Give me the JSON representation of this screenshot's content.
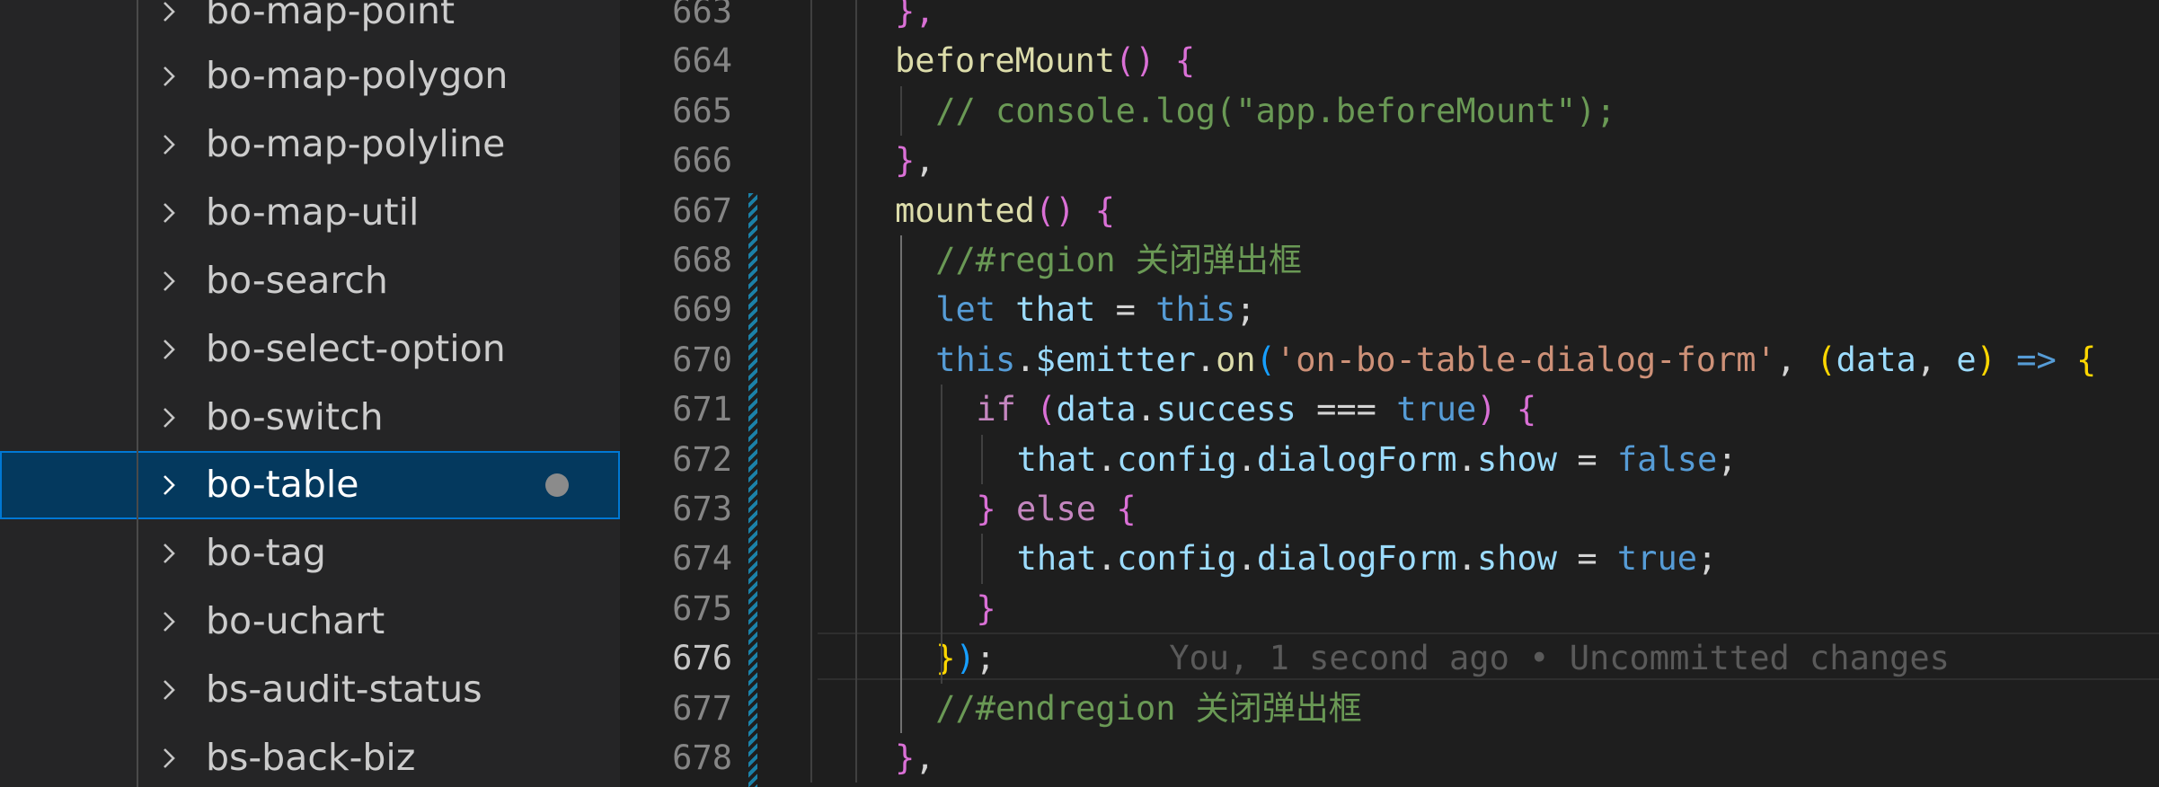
{
  "explorer": {
    "items": [
      {
        "label": "bo-map-point",
        "selected": false,
        "modified": false
      },
      {
        "label": "bo-map-polygon",
        "selected": false,
        "modified": false
      },
      {
        "label": "bo-map-polyline",
        "selected": false,
        "modified": false
      },
      {
        "label": "bo-map-util",
        "selected": false,
        "modified": false
      },
      {
        "label": "bo-search",
        "selected": false,
        "modified": false
      },
      {
        "label": "bo-select-option",
        "selected": false,
        "modified": false
      },
      {
        "label": "bo-switch",
        "selected": false,
        "modified": false
      },
      {
        "label": "bo-table",
        "selected": true,
        "modified": true
      },
      {
        "label": "bo-tag",
        "selected": false,
        "modified": false
      },
      {
        "label": "bo-uchart",
        "selected": false,
        "modified": false
      },
      {
        "label": "bs-audit-status",
        "selected": false,
        "modified": false
      },
      {
        "label": "bs-back-biz",
        "selected": false,
        "modified": false
      }
    ],
    "chevron_icon": "chevron-right-icon",
    "modified_color": "#8b8b8b",
    "selection_color": "#04395e",
    "selection_border": "#0078d4"
  },
  "editor": {
    "current_line": "676",
    "blame": "You, 1 second ago • Uncommitted changes",
    "lines": [
      {
        "num": "663",
        "tokens": [
          {
            "t": "},",
            "c": "br2"
          }
        ]
      },
      {
        "num": "664",
        "tokens": [
          {
            "t": "beforeMount",
            "c": "fn"
          },
          {
            "t": "()",
            "c": "br2"
          },
          {
            "t": " ",
            "c": "p"
          },
          {
            "t": "{",
            "c": "br2"
          }
        ]
      },
      {
        "num": "665",
        "tokens": [
          {
            "t": "// console.log(\"app.beforeMount\");",
            "c": "cmt"
          }
        ]
      },
      {
        "num": "666",
        "tokens": [
          {
            "t": "}",
            "c": "br2"
          },
          {
            "t": ",",
            "c": "p"
          }
        ]
      },
      {
        "num": "667",
        "tokens": [
          {
            "t": "mounted",
            "c": "fn"
          },
          {
            "t": "()",
            "c": "br2"
          },
          {
            "t": " ",
            "c": "p"
          },
          {
            "t": "{",
            "c": "br2"
          }
        ]
      },
      {
        "num": "668",
        "tokens": [
          {
            "t": "//#region 关闭弹出框",
            "c": "cmt"
          }
        ]
      },
      {
        "num": "669",
        "tokens": [
          {
            "t": "let",
            "c": "kw"
          },
          {
            "t": " ",
            "c": "p"
          },
          {
            "t": "that",
            "c": "var"
          },
          {
            "t": " = ",
            "c": "p"
          },
          {
            "t": "this",
            "c": "kw"
          },
          {
            "t": ";",
            "c": "p"
          }
        ]
      },
      {
        "num": "670",
        "tokens": [
          {
            "t": "this",
            "c": "kw"
          },
          {
            "t": ".",
            "c": "p"
          },
          {
            "t": "$emitter",
            "c": "var"
          },
          {
            "t": ".",
            "c": "p"
          },
          {
            "t": "on",
            "c": "fn"
          },
          {
            "t": "(",
            "c": "br3"
          },
          {
            "t": "'on-bo-table-dialog-form'",
            "c": "str"
          },
          {
            "t": ", ",
            "c": "p"
          },
          {
            "t": "(",
            "c": "br1"
          },
          {
            "t": "data",
            "c": "var"
          },
          {
            "t": ", ",
            "c": "p"
          },
          {
            "t": "e",
            "c": "var"
          },
          {
            "t": ")",
            "c": "br1"
          },
          {
            "t": " ",
            "c": "p"
          },
          {
            "t": "=>",
            "c": "kw"
          },
          {
            "t": " ",
            "c": "p"
          },
          {
            "t": "{",
            "c": "br1"
          }
        ]
      },
      {
        "num": "671",
        "tokens": [
          {
            "t": "if",
            "c": "ctl"
          },
          {
            "t": " ",
            "c": "p"
          },
          {
            "t": "(",
            "c": "br2"
          },
          {
            "t": "data",
            "c": "var"
          },
          {
            "t": ".",
            "c": "p"
          },
          {
            "t": "success",
            "c": "var"
          },
          {
            "t": " === ",
            "c": "p"
          },
          {
            "t": "true",
            "c": "kw"
          },
          {
            "t": ")",
            "c": "br2"
          },
          {
            "t": " ",
            "c": "p"
          },
          {
            "t": "{",
            "c": "br2"
          }
        ]
      },
      {
        "num": "672",
        "tokens": [
          {
            "t": "that",
            "c": "var"
          },
          {
            "t": ".",
            "c": "p"
          },
          {
            "t": "config",
            "c": "var"
          },
          {
            "t": ".",
            "c": "p"
          },
          {
            "t": "dialogForm",
            "c": "var"
          },
          {
            "t": ".",
            "c": "p"
          },
          {
            "t": "show",
            "c": "var"
          },
          {
            "t": " = ",
            "c": "p"
          },
          {
            "t": "false",
            "c": "kw"
          },
          {
            "t": ";",
            "c": "p"
          }
        ]
      },
      {
        "num": "673",
        "tokens": [
          {
            "t": "}",
            "c": "br2"
          },
          {
            "t": " ",
            "c": "p"
          },
          {
            "t": "else",
            "c": "ctl"
          },
          {
            "t": " ",
            "c": "p"
          },
          {
            "t": "{",
            "c": "br2"
          }
        ]
      },
      {
        "num": "674",
        "tokens": [
          {
            "t": "that",
            "c": "var"
          },
          {
            "t": ".",
            "c": "p"
          },
          {
            "t": "config",
            "c": "var"
          },
          {
            "t": ".",
            "c": "p"
          },
          {
            "t": "dialogForm",
            "c": "var"
          },
          {
            "t": ".",
            "c": "p"
          },
          {
            "t": "show",
            "c": "var"
          },
          {
            "t": " = ",
            "c": "p"
          },
          {
            "t": "true",
            "c": "kw"
          },
          {
            "t": ";",
            "c": "p"
          }
        ]
      },
      {
        "num": "675",
        "tokens": [
          {
            "t": "}",
            "c": "br2"
          }
        ]
      },
      {
        "num": "676",
        "tokens": [
          {
            "t": "}",
            "c": "br1"
          },
          {
            "t": ")",
            "c": "br3"
          },
          {
            "t": ";",
            "c": "p"
          }
        ]
      },
      {
        "num": "677",
        "tokens": [
          {
            "t": "//#endregion 关闭弹出框",
            "c": "cmt"
          }
        ]
      },
      {
        "num": "678",
        "tokens": [
          {
            "t": "}",
            "c": "br2"
          },
          {
            "t": ",",
            "c": "p"
          }
        ]
      }
    ],
    "colors": {
      "fn": "#dcdcaa",
      "var": "#9cdcfe",
      "kw": "#569cd6",
      "ctl": "#c586c0",
      "str": "#ce9178",
      "cmt": "#6a9955",
      "p": "#d4d4d4",
      "br1": "#ffd700",
      "br2": "#da70d6",
      "br3": "#179fff"
    }
  }
}
